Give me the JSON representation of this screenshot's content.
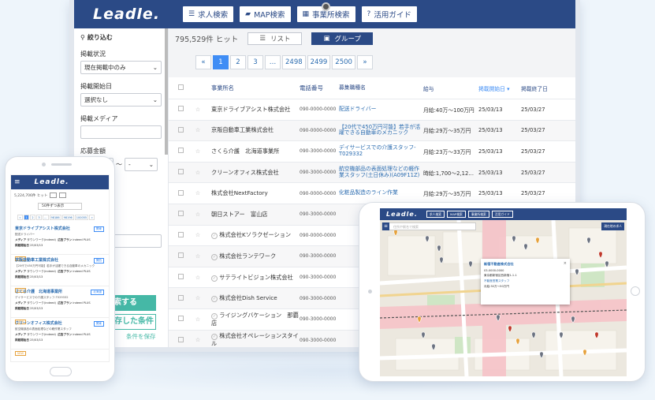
{
  "brand": "Leadle.",
  "laptop": {
    "nav": [
      {
        "label": "求人検索",
        "icon": "list-icon"
      },
      {
        "label": "MAP検索",
        "icon": "map-icon"
      },
      {
        "label": "事業所検索",
        "icon": "building-icon"
      },
      {
        "label": "活用ガイド",
        "icon": "help-icon"
      }
    ],
    "sidebar": {
      "title": "絞り込む",
      "status_label": "掲載状況",
      "status_value": "現在掲載中のみ",
      "start_label": "掲載開始日",
      "start_value": "選択なし",
      "media_label": "掲載メディア",
      "amount_label": "応募金額",
      "amount_sep": "〜",
      "amount_from": "-",
      "amount_to": "-"
    },
    "hits": "795,529件 ヒット",
    "view_list": "リスト",
    "view_group": "グループ",
    "pager": [
      "«",
      "1",
      "2",
      "3",
      "…",
      "2498",
      "2499",
      "2500",
      "»"
    ],
    "pager_active": "1",
    "columns": [
      "事業所名",
      "電話番号",
      "募集職種名",
      "給与",
      "掲載開始日 ▾",
      "掲載終了日"
    ],
    "rows": [
      {
        "name": "東京ドライブアシスト株式会社",
        "tel": "090-0000-0000",
        "job": "配送ドライバー",
        "pay": "月給:40万〜100万円",
        "start": "25/03/13",
        "end": "25/03/27"
      },
      {
        "name": "京阪自動車工業株式会社",
        "tel": "090-0000-0000",
        "job": "【20代で450万円可能】若手が活躍できる自動車のメカニック",
        "pay": "月給:29万〜35万円",
        "start": "25/03/13",
        "end": "25/03/27"
      },
      {
        "name": "さくら介護　北海道事業所",
        "tel": "090-3000-0000",
        "job": "デイサービスでの介護スタッフ-T029332",
        "pay": "月給:23万〜33万円",
        "start": "25/03/13",
        "end": "25/03/27"
      },
      {
        "name": "クリーンオフィス株式会社",
        "tel": "090-3000-0000",
        "job": "航空機部品の表面処理などの軽作業スタッフ(土日休み)(A09F11Z)",
        "pay": "時給:1,700〜2,12…",
        "start": "25/03/13",
        "end": "25/03/27"
      },
      {
        "name": "株式会社NextFactory",
        "tel": "090-0000-0000",
        "job": "化粧品製造のライン作業",
        "pay": "月給:29万〜35万円",
        "start": "25/03/13",
        "end": "25/03/27"
      },
      {
        "name": "朝日ストアー　富山店",
        "tel": "090-3000-0000",
        "job": "",
        "pay": "",
        "start": "25/03/13",
        "end": "25/03/27"
      },
      {
        "name": "株式会社Kソラクゼーション",
        "tel": "090-0000-0000",
        "job": "",
        "pay": "",
        "start": "25/03/13",
        "end": "25/03/27"
      },
      {
        "name": "株式会社ランテワーク",
        "tel": "090-3000-0000",
        "job": "",
        "pay": "",
        "start": "25/03/13",
        "end": "25/03/27"
      },
      {
        "name": "サテライトビジョン株式会社",
        "tel": "090-3000-0000",
        "job": "",
        "pay": "",
        "start": "25/03/13",
        "end": "25/03/27"
      },
      {
        "name": "株式会社Dish Service",
        "tel": "090-3000-0000",
        "job": "",
        "pay": "",
        "start": "25/03/13",
        "end": "25/03/27"
      },
      {
        "name": "ライジングバケーション　那覇店",
        "tel": "090-3000-0000",
        "job": "",
        "pay": "",
        "start": "25/03/13",
        "end": "25/03/27"
      },
      {
        "name": "株式会社オペレーションスタイル",
        "tel": "090-3000-0000",
        "job": "",
        "pay": "",
        "start": "25/03/13",
        "end": "25/03/27"
      }
    ],
    "search_button": "検索する",
    "saved_button": "保存した条件",
    "save_footer": "条件を保存"
  },
  "phone": {
    "hits": "5,224,706件 ヒット",
    "per_page": "50件ずつ表示",
    "pager": [
      "«",
      "1",
      "2",
      "3",
      "…",
      "98186",
      "98196",
      "100055",
      "»"
    ],
    "items": [
      {
        "name": "東京ドライブアシスト株式会社",
        "desc": "配送ドライバー",
        "media": "メディア",
        "media_v": "タウンワーク(indeed)",
        "plan": "広告プラン",
        "plan_v": "indeed PLUS",
        "date_l": "掲載開始日",
        "date": "25/03/13",
        "tag": "関東"
      },
      {
        "name": "京阪自動車工業株式会社",
        "desc": "【20代で450万円可能】若手が活躍できる自動車のメカニック",
        "media": "メディア",
        "media_v": "タウンワーク(indeed)",
        "plan": "広告プラン",
        "plan_v": "indeed PLUS",
        "date_l": "掲載開始日",
        "date": "25/03/13",
        "tag": "関西"
      },
      {
        "name": "さくら介護　北海道事業所",
        "desc": "デイサービスでの介護スタッフ-T029332",
        "media": "メディア",
        "media_v": "タウンワーク(indeed)",
        "plan": "広告プラン",
        "plan_v": "indeed PLUS",
        "date_l": "掲載開始日",
        "date": "25/03/13",
        "tag": "北海道"
      },
      {
        "name": "クリーンオフィス株式会社",
        "desc": "航空機部品の表面処理などの軽作業スタッフ",
        "media": "メディア",
        "media_v": "タウンワーク(indeed)",
        "plan": "広告プラン",
        "plan_v": "indeed PLUS",
        "date_l": "掲載開始日",
        "date": "25/03/13",
        "tag": "関東"
      }
    ],
    "new_badge": "NEW"
  },
  "tablet": {
    "nav": [
      "求人検索",
      "MAP検索",
      "事業所検索",
      "活用ガイド"
    ],
    "search_placeholder": "住所や駅名で検索",
    "right_button": "現在地の求人",
    "popup": {
      "title": "新宿不動産株式会社",
      "tel": "03-0000-0000",
      "address": "東京都新宿区西新宿1-1-1",
      "job": "不動産営業スタッフ",
      "pay": "月給:30万〜50万円",
      "close": "×"
    }
  },
  "colors": {
    "navy": "#2b4a86",
    "accent": "#3f8df5",
    "green": "#45b8a6"
  }
}
